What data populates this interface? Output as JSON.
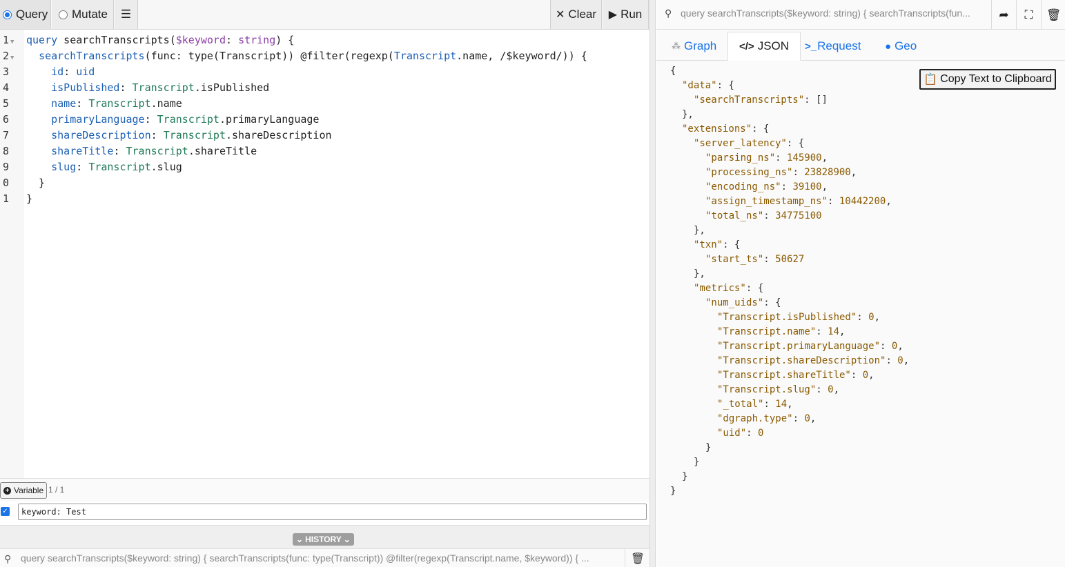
{
  "toolbar": {
    "query_label": "Query",
    "mutate_label": "Mutate",
    "settings_icon": "sliders-icon",
    "clear_label": "Clear",
    "run_label": "Run"
  },
  "editor": {
    "line_numbers": [
      "1",
      "2",
      "3",
      "4",
      "5",
      "6",
      "7",
      "8",
      "9",
      "0",
      "1"
    ],
    "lines": [
      [
        {
          "t": "query",
          "c": "kw"
        },
        {
          "t": " searchTranscripts(",
          "c": ""
        },
        {
          "t": "$keyword",
          "c": "var"
        },
        {
          "t": ": ",
          "c": ""
        },
        {
          "t": "string",
          "c": "var"
        },
        {
          "t": ") {",
          "c": ""
        }
      ],
      [
        {
          "t": "  ",
          "c": ""
        },
        {
          "t": "searchTranscripts",
          "c": "fn"
        },
        {
          "t": "(func: type(Transcript)) @filter(regexp(",
          "c": ""
        },
        {
          "t": "Transcript",
          "c": "fn"
        },
        {
          "t": ".name, /$keyword/)) {",
          "c": ""
        }
      ],
      [
        {
          "t": "    ",
          "c": ""
        },
        {
          "t": "id",
          "c": "fn"
        },
        {
          "t": ": ",
          "c": ""
        },
        {
          "t": "uid",
          "c": "fn"
        }
      ],
      [
        {
          "t": "    ",
          "c": ""
        },
        {
          "t": "isPublished",
          "c": "fn"
        },
        {
          "t": ": ",
          "c": ""
        },
        {
          "t": "Transcript",
          "c": "typ"
        },
        {
          "t": ".isPublished",
          "c": ""
        }
      ],
      [
        {
          "t": "    ",
          "c": ""
        },
        {
          "t": "name",
          "c": "fn"
        },
        {
          "t": ": ",
          "c": ""
        },
        {
          "t": "Transcript",
          "c": "typ"
        },
        {
          "t": ".name",
          "c": ""
        }
      ],
      [
        {
          "t": "    ",
          "c": ""
        },
        {
          "t": "primaryLanguage",
          "c": "fn"
        },
        {
          "t": ": ",
          "c": ""
        },
        {
          "t": "Transcript",
          "c": "typ"
        },
        {
          "t": ".primaryLanguage",
          "c": ""
        }
      ],
      [
        {
          "t": "    ",
          "c": ""
        },
        {
          "t": "shareDescription",
          "c": "fn"
        },
        {
          "t": ": ",
          "c": ""
        },
        {
          "t": "Transcript",
          "c": "typ"
        },
        {
          "t": ".shareDescription",
          "c": ""
        }
      ],
      [
        {
          "t": "    ",
          "c": ""
        },
        {
          "t": "shareTitle",
          "c": "fn"
        },
        {
          "t": ": ",
          "c": ""
        },
        {
          "t": "Transcript",
          "c": "typ"
        },
        {
          "t": ".shareTitle",
          "c": ""
        }
      ],
      [
        {
          "t": "    ",
          "c": ""
        },
        {
          "t": "slug",
          "c": "fn"
        },
        {
          "t": ": ",
          "c": ""
        },
        {
          "t": "Transcript",
          "c": "typ"
        },
        {
          "t": ".slug",
          "c": ""
        }
      ],
      [
        {
          "t": "  }",
          "c": ""
        }
      ],
      [
        {
          "t": "}",
          "c": ""
        }
      ]
    ]
  },
  "variables": {
    "button_label": "Variable",
    "count": "1 / 1",
    "value": "keyword: Test"
  },
  "history": {
    "label": "HISTORY",
    "item": "query searchTranscripts($keyword: string) { searchTranscripts(func: type(Transcript)) @filter(regexp(Transcript.name, $keyword)) { ..."
  },
  "result_header": {
    "query": "query searchTranscripts($keyword: string) { searchTranscripts(fun..."
  },
  "tabs": [
    {
      "label": "Graph",
      "icon": "graph-icon"
    },
    {
      "label": "JSON",
      "icon": "code-icon"
    },
    {
      "label": "Request",
      "icon": "terminal-icon"
    },
    {
      "label": "Geo",
      "icon": "globe-icon"
    }
  ],
  "copy_button": "Copy Text to Clipboard",
  "json_lines": [
    {
      "i": 0,
      "k": "",
      "v": "{"
    },
    {
      "i": 1,
      "k": "\"data\"",
      "v": ": {"
    },
    {
      "i": 2,
      "k": "\"searchTranscripts\"",
      "v": ": []"
    },
    {
      "i": 1,
      "k": "",
      "v": "},"
    },
    {
      "i": 1,
      "k": "\"extensions\"",
      "v": ": {"
    },
    {
      "i": 2,
      "k": "\"server_latency\"",
      "v": ": {"
    },
    {
      "i": 3,
      "k": "\"parsing_ns\"",
      "v": ": 145900,"
    },
    {
      "i": 3,
      "k": "\"processing_ns\"",
      "v": ": 23828900,"
    },
    {
      "i": 3,
      "k": "\"encoding_ns\"",
      "v": ": 39100,"
    },
    {
      "i": 3,
      "k": "\"assign_timestamp_ns\"",
      "v": ": 10442200,"
    },
    {
      "i": 3,
      "k": "\"total_ns\"",
      "v": ": 34775100"
    },
    {
      "i": 2,
      "k": "",
      "v": "},"
    },
    {
      "i": 2,
      "k": "\"txn\"",
      "v": ": {"
    },
    {
      "i": 3,
      "k": "\"start_ts\"",
      "v": ": 50627"
    },
    {
      "i": 2,
      "k": "",
      "v": "},"
    },
    {
      "i": 2,
      "k": "\"metrics\"",
      "v": ": {"
    },
    {
      "i": 3,
      "k": "\"num_uids\"",
      "v": ": {"
    },
    {
      "i": 4,
      "k": "\"Transcript.isPublished\"",
      "v": ": 0,"
    },
    {
      "i": 4,
      "k": "\"Transcript.name\"",
      "v": ": 14,"
    },
    {
      "i": 4,
      "k": "\"Transcript.primaryLanguage\"",
      "v": ": 0,"
    },
    {
      "i": 4,
      "k": "\"Transcript.shareDescription\"",
      "v": ": 0,"
    },
    {
      "i": 4,
      "k": "\"Transcript.shareTitle\"",
      "v": ": 0,"
    },
    {
      "i": 4,
      "k": "\"Transcript.slug\"",
      "v": ": 0,"
    },
    {
      "i": 4,
      "k": "\"_total\"",
      "v": ": 14,"
    },
    {
      "i": 4,
      "k": "\"dgraph.type\"",
      "v": ": 0,"
    },
    {
      "i": 4,
      "k": "\"uid\"",
      "v": ": 0"
    },
    {
      "i": 3,
      "k": "",
      "v": "}"
    },
    {
      "i": 2,
      "k": "",
      "v": "}"
    },
    {
      "i": 1,
      "k": "",
      "v": "}"
    },
    {
      "i": 0,
      "k": "",
      "v": "}"
    }
  ]
}
